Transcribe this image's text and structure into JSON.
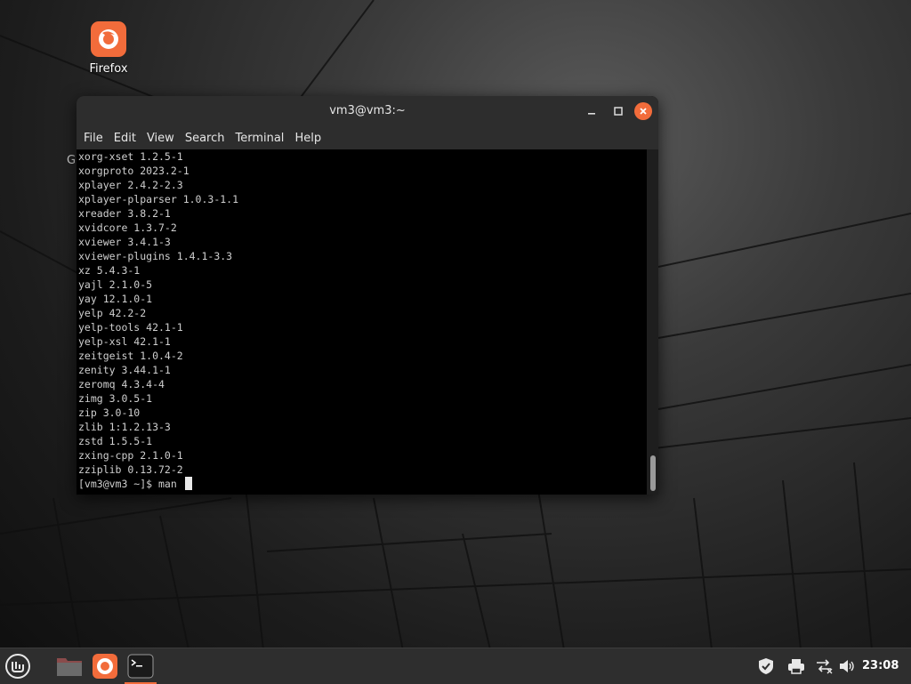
{
  "desktop": {
    "icons": [
      {
        "label": "Firefox",
        "icon": "firefox-icon"
      }
    ],
    "stray_text": "G"
  },
  "window": {
    "title": "vm3@vm3:~",
    "menu": [
      "File",
      "Edit",
      "View",
      "Search",
      "Terminal",
      "Help"
    ],
    "terminal_lines": [
      "xorg-xset 1.2.5-1",
      "xorgproto 2023.2-1",
      "xplayer 2.4.2-2.3",
      "xplayer-plparser 1.0.3-1.1",
      "xreader 3.8.2-1",
      "xvidcore 1.3.7-2",
      "xviewer 3.4.1-3",
      "xviewer-plugins 1.4.1-3.3",
      "xz 5.4.3-1",
      "yajl 2.1.0-5",
      "yay 12.1.0-1",
      "yelp 42.2-2",
      "yelp-tools 42.1-1",
      "yelp-xsl 42.1-1",
      "zeitgeist 1.0.4-2",
      "zenity 3.44.1-1",
      "zeromq 4.3.4-4",
      "zimg 3.0.5-1",
      "zip 3.0-10",
      "zlib 1:1.2.13-3",
      "zstd 1.5.5-1",
      "zxing-cpp 2.1.0-1",
      "zziplib 0.13.72-2"
    ],
    "prompt": "[vm3@vm3 ~]$ man "
  },
  "taskbar": {
    "clock": "23:08",
    "launchers": [
      "mint-menu-icon",
      "files-icon",
      "firefox-icon",
      "terminal-icon"
    ],
    "tray": [
      "shield-icon",
      "printer-icon",
      "network-icon",
      "volume-icon"
    ]
  },
  "colors": {
    "accent": "#f26c3b",
    "terminal_bg": "#000000",
    "titlebar": "#2d2d2d",
    "taskbar": "#2e2e2e"
  }
}
